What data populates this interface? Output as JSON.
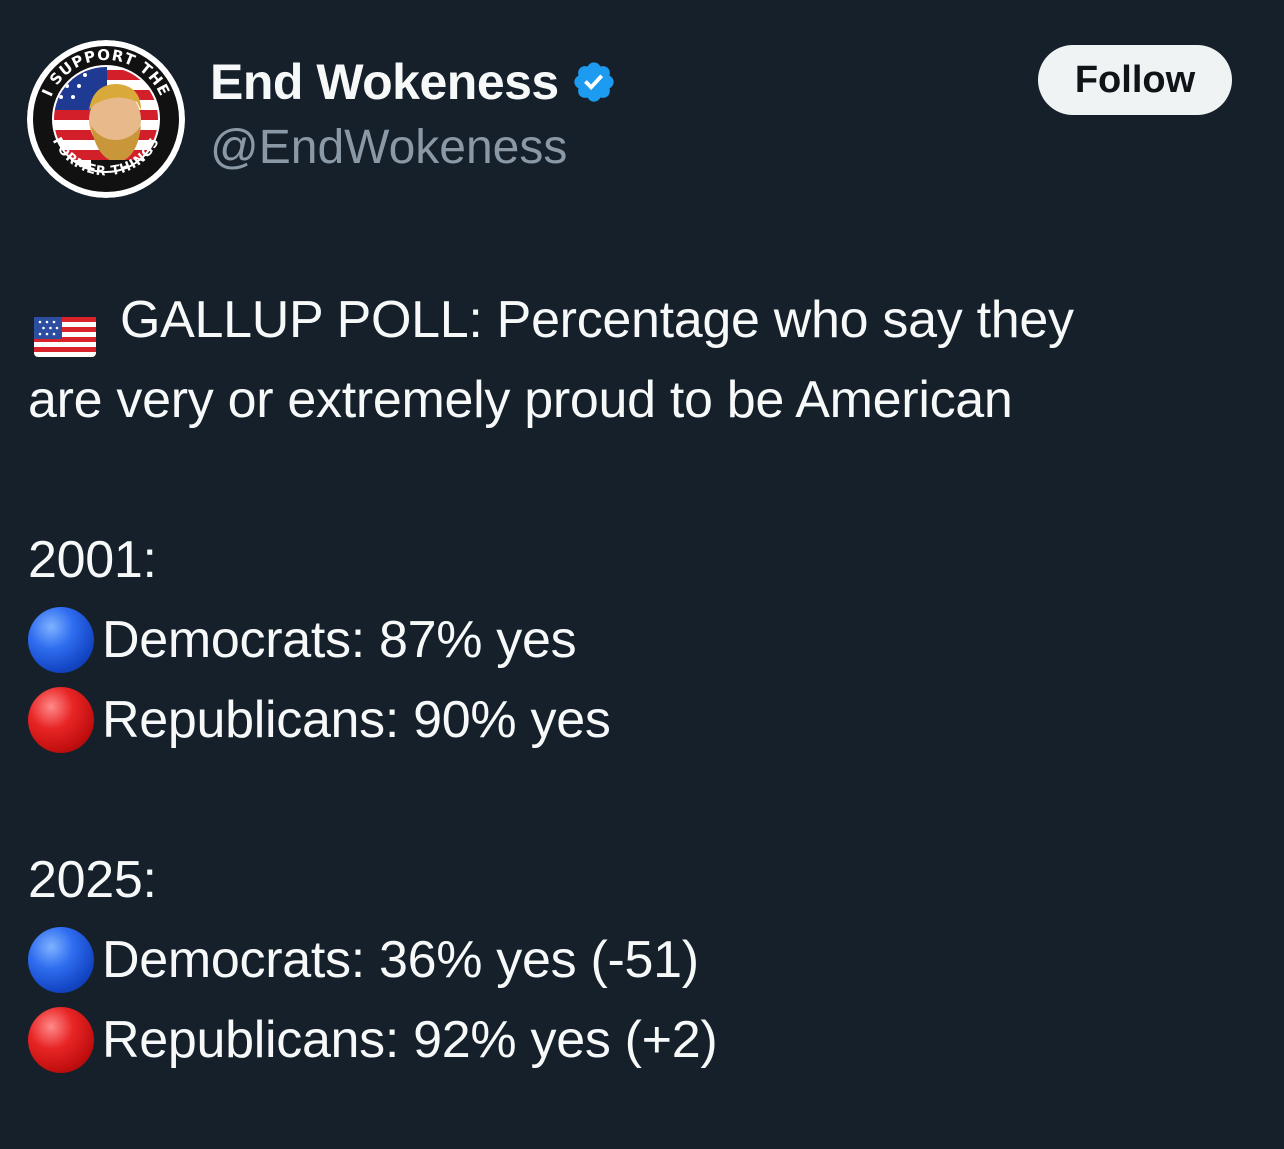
{
  "header": {
    "display_name": "End Wokeness",
    "handle": "@EndWokeness",
    "follow_label": "Follow",
    "avatar": {
      "top_text": "I SUPPORT THE",
      "bottom_text": "FORMER THINGS"
    }
  },
  "post": {
    "lines": [
      {
        "icon": "us-flag-icon",
        "text": "GALLUP POLL: Percentage who say they"
      },
      {
        "icon": null,
        "text": "are very or extremely proud to be American"
      },
      {
        "icon": null,
        "text": ""
      },
      {
        "icon": null,
        "text": "2001:"
      },
      {
        "icon": "blue-circle-icon",
        "text": "Democrats: 87% yes"
      },
      {
        "icon": "red-circle-icon",
        "text": "Republicans: 90% yes"
      },
      {
        "icon": null,
        "text": ""
      },
      {
        "icon": null,
        "text": "2025:"
      },
      {
        "icon": "blue-circle-icon",
        "text": "Democrats: 36% yes (-51)"
      },
      {
        "icon": "red-circle-icon",
        "text": "Republicans: 92% yes (+2)"
      }
    ]
  },
  "colors": {
    "background": "#15202b",
    "text_primary": "#f7f9f9",
    "text_secondary": "#8b98a5",
    "verified_blue": "#1d9bf0",
    "follow_bg": "#eff3f4",
    "follow_text": "#0f1419"
  }
}
